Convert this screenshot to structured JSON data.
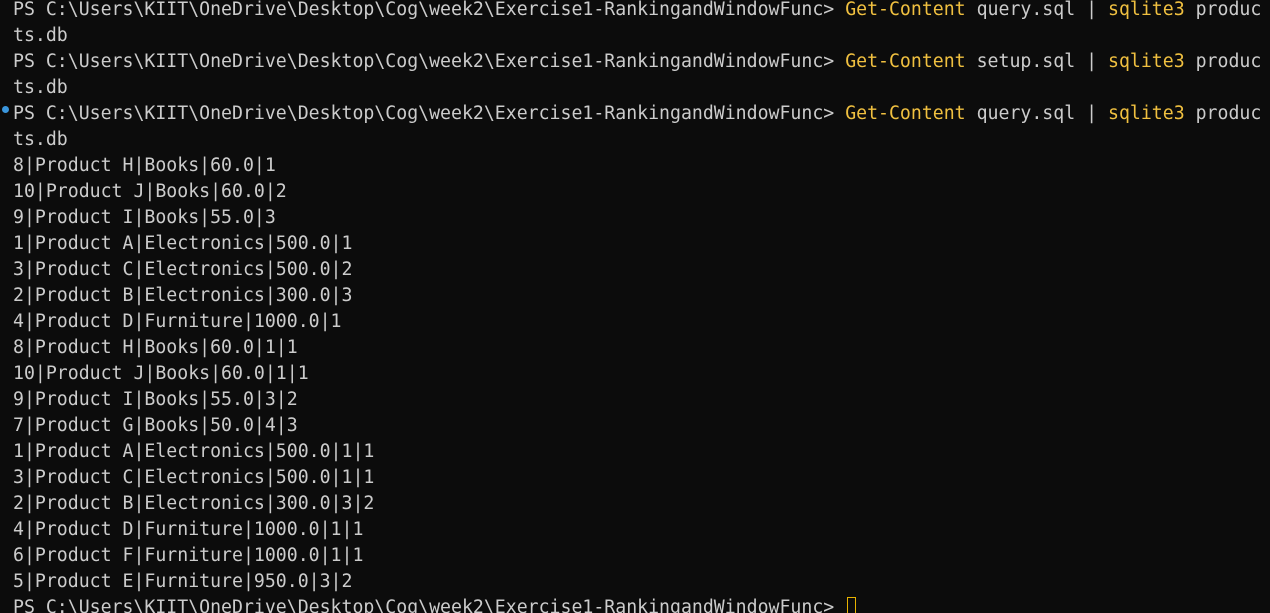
{
  "colors": {
    "background": "#0c0c0c",
    "text": "#cccccc",
    "command": "#f0c040",
    "marker": "#3a96dd"
  },
  "prompt": "PS C:\\Users\\KIIT\\OneDrive\\Desktop\\Cog\\week2\\Exercise1-RankingandWindowFunc> ",
  "commands": [
    {
      "get": "Get-Content",
      "file": " query.sql ",
      "pipe": "| ",
      "sqlite": "sqlite3",
      "args": " produc",
      "wrap": "ts.db"
    },
    {
      "get": "Get-Content",
      "file": " setup.sql ",
      "pipe": "| ",
      "sqlite": "sqlite3",
      "args": " produc",
      "wrap": "ts.db"
    },
    {
      "get": "Get-Content",
      "file": " query.sql ",
      "pipe": "| ",
      "sqlite": "sqlite3",
      "args": " produc",
      "wrap": "ts.db"
    }
  ],
  "output": [
    "8|Product H|Books|60.0|1",
    "10|Product J|Books|60.0|2",
    "9|Product I|Books|55.0|3",
    "1|Product A|Electronics|500.0|1",
    "3|Product C|Electronics|500.0|2",
    "2|Product B|Electronics|300.0|3",
    "4|Product D|Furniture|1000.0|1",
    "8|Product H|Books|60.0|1|1",
    "10|Product J|Books|60.0|1|1",
    "9|Product I|Books|55.0|3|2",
    "7|Product G|Books|50.0|4|3",
    "1|Product A|Electronics|500.0|1|1",
    "3|Product C|Electronics|500.0|1|1",
    "2|Product B|Electronics|300.0|3|2",
    "4|Product D|Furniture|1000.0|1|1",
    "6|Product F|Furniture|1000.0|1|1",
    "5|Product E|Furniture|950.0|3|2"
  ]
}
